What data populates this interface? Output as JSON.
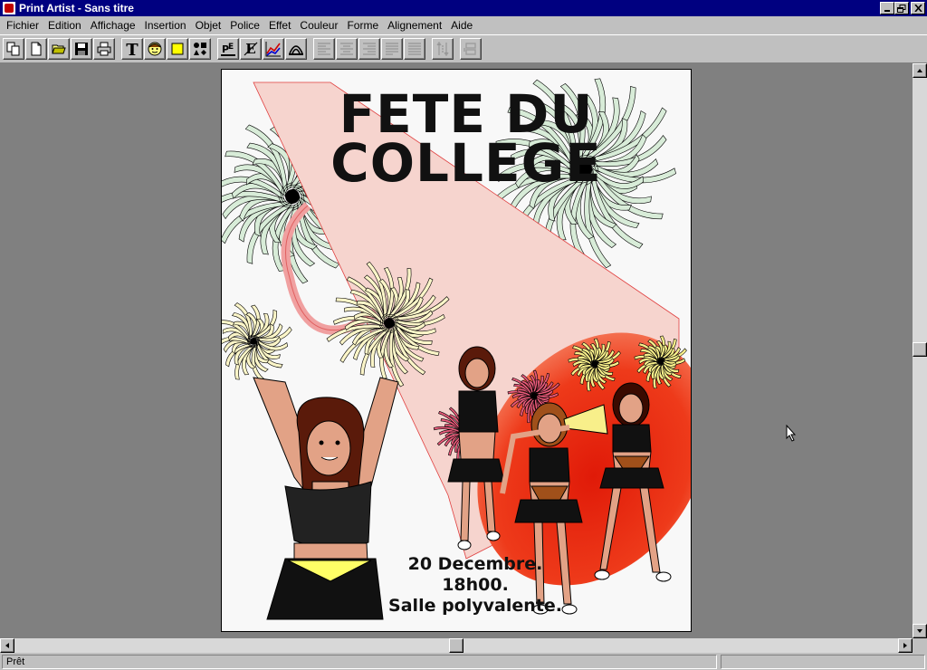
{
  "window": {
    "title": "Print Artist - Sans titre",
    "buttons": {
      "minimize": "_",
      "maximize": "▫",
      "close": "×"
    }
  },
  "menu": [
    "Fichier",
    "Edition",
    "Affichage",
    "Insertion",
    "Objet",
    "Police",
    "Effet",
    "Couleur",
    "Forme",
    "Alignement",
    "Aide"
  ],
  "toolbar": {
    "buttons": [
      "copy-icon",
      "new-file-icon",
      "open-folder-icon",
      "save-icon",
      "print-icon",
      "text-tool-icon",
      "graphic-face-icon",
      "color-fill-icon",
      "shapes-icon",
      "headline-icon",
      "text-effect-icon",
      "chart-icon",
      "smart-art-icon",
      "align-left-icon",
      "align-center-icon",
      "align-right-icon",
      "justify-icon",
      "justify-full-icon",
      "vertical-spacing-icon",
      "layer-icon"
    ]
  },
  "poster": {
    "headline_line1": "FETE DU",
    "headline_line2": "COLLEGE",
    "date": "20 Decembre.",
    "time": "18h00.",
    "location": "Salle polyvalente."
  },
  "status": {
    "text": "Prêt"
  },
  "colors": {
    "titlebar": "#000080",
    "workspace": "#808080",
    "chrome": "#c0c0c0",
    "megaphone": "#f6d4ce",
    "spotlight": "#ea2a10"
  }
}
